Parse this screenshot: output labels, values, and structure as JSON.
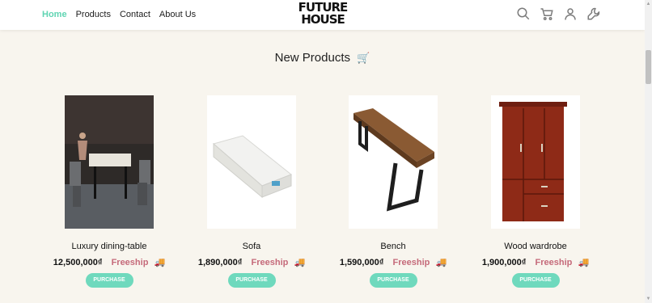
{
  "header": {
    "nav": [
      "Home",
      "Products",
      "Contact",
      "About Us"
    ],
    "logo_line1": "FUTURE",
    "logo_line2": "HOUSE",
    "icons": [
      "search-icon",
      "cart-icon",
      "user-icon",
      "wrench-icon"
    ],
    "accent_color": "#5fd4b2"
  },
  "section": {
    "title": "New Products",
    "emoji": "🛒"
  },
  "products": [
    {
      "name": "Luxury dining-table",
      "price": "12,500,000₫",
      "shipping": "Freeship",
      "truck": "🚚",
      "button": "PURCHASE"
    },
    {
      "name": "Sofa",
      "price": "1,890,000₫",
      "shipping": "Freeship",
      "truck": "🚚",
      "button": "PURCHASE"
    },
    {
      "name": "Bench",
      "price": "1,590,000₫",
      "shipping": "Freeship",
      "truck": "🚚",
      "button": "PURCHASE"
    },
    {
      "name": "Wood wardrobe",
      "price": "1,900,000₫",
      "shipping": "Freeship",
      "truck": "🚚",
      "button": "PURCHASE"
    }
  ],
  "colors": {
    "button": "#6fd9bd",
    "freeship": "#c56a7a",
    "background": "#f8f5ee"
  }
}
